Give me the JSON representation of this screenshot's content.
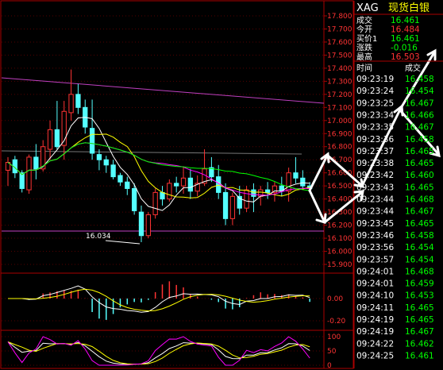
{
  "instrument": {
    "code": "XAG",
    "name": "现货白银"
  },
  "quote": [
    {
      "label": "成交",
      "value": "16.461",
      "color": "#00ff00"
    },
    {
      "label": "今开",
      "value": "16.484",
      "color": "#ff3333"
    },
    {
      "label": "买价1",
      "value": "16.461",
      "color": "#00ff00"
    },
    {
      "label": "涨跌",
      "value": "-0.016",
      "color": "#00ff00"
    },
    {
      "label": "最高",
      "value": "16.503",
      "color": "#ff3333"
    }
  ],
  "ticks_header": {
    "time": "时间",
    "price": "成交"
  },
  "ticks": [
    {
      "time": "09:23:19",
      "price": "16.458",
      "color": "#00ff00"
    },
    {
      "time": "09:23:24",
      "price": "16.454",
      "color": "#00ff00"
    },
    {
      "time": "09:23:25",
      "price": "16.467",
      "color": "#00ff00"
    },
    {
      "time": "09:23:34",
      "price": "16.466",
      "color": "#00ff00"
    },
    {
      "time": "09:23:35",
      "price": "16.467",
      "color": "#00ff00"
    },
    {
      "time": "09:23:36",
      "price": "16.458",
      "color": "#00ff00"
    },
    {
      "time": "09:23:37",
      "price": "16.465",
      "color": "#00ff00"
    },
    {
      "time": "09:23:38",
      "price": "16.465",
      "color": "#00ff00"
    },
    {
      "time": "09:23:42",
      "price": "16.460",
      "color": "#00ff00"
    },
    {
      "time": "09:23:43",
      "price": "16.465",
      "color": "#00ff00"
    },
    {
      "time": "09:23:44",
      "price": "16.468",
      "color": "#00ff00"
    },
    {
      "time": "09:23:44",
      "price": "16.467",
      "color": "#00ff00"
    },
    {
      "time": "09:23:45",
      "price": "16.465",
      "color": "#00ff00"
    },
    {
      "time": "09:23:46",
      "price": "16.458",
      "color": "#00ff00"
    },
    {
      "time": "09:23:56",
      "price": "16.454",
      "color": "#00ff00"
    },
    {
      "time": "09:23:57",
      "price": "16.454",
      "color": "#00ff00"
    },
    {
      "time": "09:24:01",
      "price": "16.468",
      "color": "#00ff00"
    },
    {
      "time": "09:24:01",
      "price": "16.459",
      "color": "#00ff00"
    },
    {
      "time": "09:24:10",
      "price": "16.453",
      "color": "#00ff00"
    },
    {
      "time": "09:24:11",
      "price": "16.465",
      "color": "#00ff00"
    },
    {
      "time": "09:24:19",
      "price": "16.465",
      "color": "#00ff00"
    },
    {
      "time": "09:24:19",
      "price": "16.467",
      "color": "#00ff00"
    },
    {
      "time": "09:24:22",
      "price": "16.462",
      "color": "#00ff00"
    },
    {
      "time": "09:24:25",
      "price": "16.461",
      "color": "#00ff00"
    }
  ],
  "price_axis": {
    "labels": [
      "17.800",
      "17.700",
      "17.600",
      "17.500",
      "17.400",
      "17.300",
      "17.200",
      "17.100",
      "17.000",
      "16.900",
      "16.800",
      "16.700",
      "16.600",
      "16.500",
      "16.400",
      "16.300",
      "16.200",
      "16.100",
      "16.000",
      "15.900"
    ],
    "min": 15.9,
    "max": 17.8
  },
  "low_annotation": "16.034",
  "macd_axis": {
    "labels": [
      "0.00",
      "-0.20"
    ]
  },
  "kdj_axis": {
    "labels": [
      "100",
      "50",
      "0"
    ]
  },
  "colors": {
    "up": "#ff3333",
    "down": "#54ffff",
    "frame": "#aa0000",
    "text_red": "#ff3333",
    "text_green": "#00ff00",
    "trendline": "#c040c0"
  },
  "chart_data": {
    "type": "candlestick",
    "series_ohlc": [
      [
        16.62,
        16.72,
        16.5,
        16.68
      ],
      [
        16.7,
        16.73,
        16.56,
        16.6
      ],
      [
        16.6,
        16.62,
        16.45,
        16.48
      ],
      [
        16.47,
        16.74,
        16.44,
        16.72
      ],
      [
        16.72,
        16.82,
        16.55,
        16.63
      ],
      [
        16.63,
        16.85,
        16.61,
        16.8
      ],
      [
        16.78,
        17.0,
        16.7,
        16.93
      ],
      [
        16.93,
        17.15,
        16.78,
        16.8
      ],
      [
        16.81,
        17.15,
        16.7,
        17.07
      ],
      [
        17.06,
        17.39,
        17.0,
        17.2
      ],
      [
        17.2,
        17.28,
        17.05,
        17.1
      ],
      [
        17.1,
        17.16,
        16.9,
        16.95
      ],
      [
        16.94,
        17.16,
        16.7,
        16.75
      ],
      [
        16.74,
        16.78,
        16.62,
        16.7
      ],
      [
        16.7,
        16.73,
        16.6,
        16.66
      ],
      [
        16.66,
        16.7,
        16.55,
        16.57
      ],
      [
        16.58,
        16.6,
        16.5,
        16.53
      ],
      [
        16.53,
        16.57,
        16.43,
        16.48
      ],
      [
        16.48,
        16.52,
        16.28,
        16.31
      ],
      [
        16.3,
        16.35,
        16.07,
        16.12
      ],
      [
        16.12,
        16.3,
        16.1,
        16.28
      ],
      [
        16.28,
        16.48,
        16.25,
        16.45
      ],
      [
        16.45,
        16.5,
        16.35,
        16.4
      ],
      [
        16.4,
        16.55,
        16.38,
        16.52
      ],
      [
        16.52,
        16.57,
        16.45,
        16.5
      ],
      [
        16.5,
        16.65,
        16.44,
        16.56
      ],
      [
        16.56,
        16.63,
        16.4,
        16.46
      ],
      [
        16.46,
        16.58,
        16.42,
        16.52
      ],
      [
        16.52,
        16.78,
        16.5,
        16.63
      ],
      [
        16.64,
        16.72,
        16.53,
        16.57
      ],
      [
        16.57,
        16.66,
        16.4,
        16.45
      ],
      [
        16.45,
        16.52,
        16.2,
        16.25
      ],
      [
        16.25,
        16.45,
        16.2,
        16.42
      ],
      [
        16.42,
        16.5,
        16.28,
        16.33
      ],
      [
        16.33,
        16.5,
        16.3,
        16.47
      ],
      [
        16.47,
        16.52,
        16.3,
        16.42
      ],
      [
        16.42,
        16.5,
        16.35,
        16.47
      ],
      [
        16.47,
        16.53,
        16.4,
        16.45
      ],
      [
        16.45,
        16.53,
        16.38,
        16.5
      ],
      [
        16.5,
        16.57,
        16.42,
        16.46
      ],
      [
        16.46,
        16.64,
        16.38,
        16.6
      ],
      [
        16.6,
        16.72,
        16.52,
        16.56
      ],
      [
        16.56,
        16.62,
        16.48,
        16.5
      ],
      [
        16.5,
        16.53,
        16.45,
        16.48
      ]
    ],
    "ylim": [
      15.9,
      17.8
    ]
  }
}
